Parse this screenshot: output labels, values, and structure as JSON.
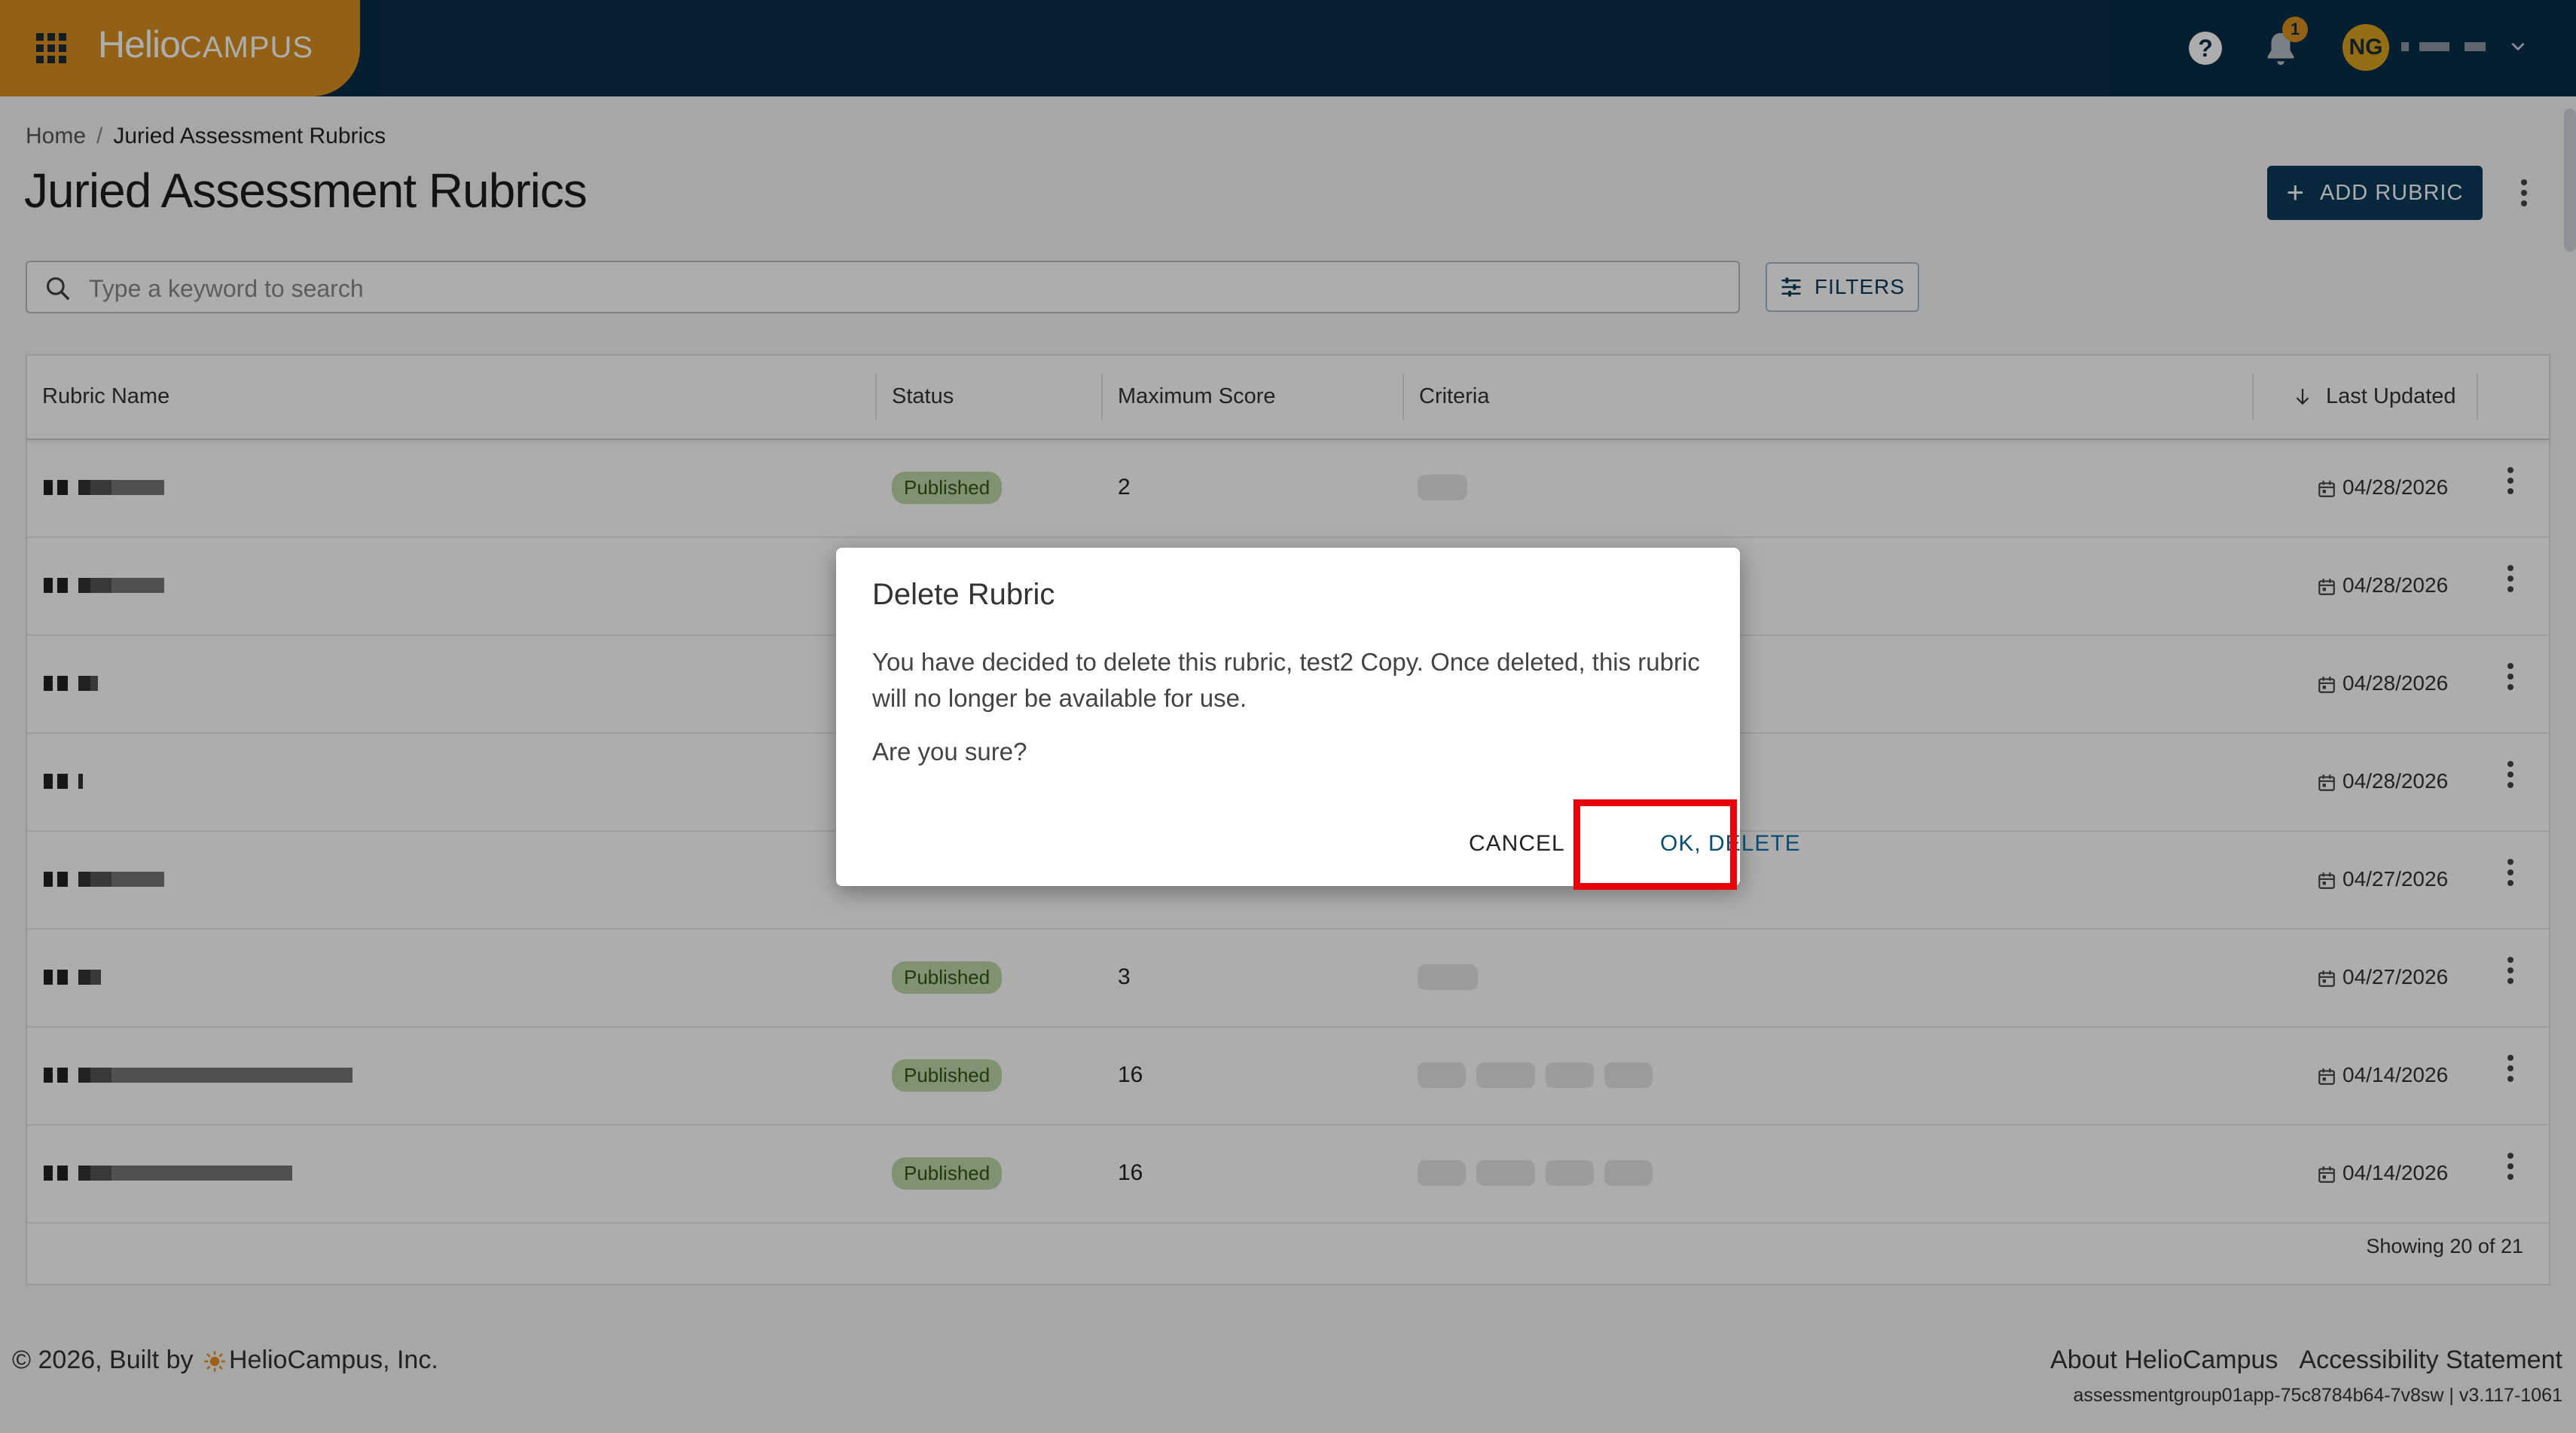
{
  "topbar": {
    "logo_bold": "Helio",
    "logo_light": "CAMPUS",
    "help_label": "?",
    "notification_count": "1",
    "avatar_initials": "NG"
  },
  "breadcrumb": {
    "home": "Home",
    "separator": "/",
    "current": "Juried Assessment Rubrics"
  },
  "page_title": "Juried Assessment Rubrics",
  "actions": {
    "add_label": "ADD RUBRIC",
    "filters_label": "FILTERS"
  },
  "search": {
    "placeholder": "Type a keyword to search"
  },
  "table": {
    "headers": {
      "name": "Rubric Name",
      "status": "Status",
      "max_score": "Maximum Score",
      "criteria": "Criteria",
      "updated": "Last Updated"
    },
    "rows": [
      {
        "status": "Published",
        "max_score": "2",
        "updated": "04/28/2026"
      },
      {
        "status": "",
        "max_score": "",
        "updated": "04/28/2026"
      },
      {
        "status": "",
        "max_score": "",
        "updated": "04/28/2026"
      },
      {
        "status": "",
        "max_score": "",
        "updated": "04/28/2026"
      },
      {
        "status": "",
        "max_score": "",
        "updated": "04/27/2026"
      },
      {
        "status": "Published",
        "max_score": "3",
        "updated": "04/27/2026"
      },
      {
        "status": "Published",
        "max_score": "16",
        "updated": "04/14/2026"
      },
      {
        "status": "Published",
        "max_score": "16",
        "updated": "04/14/2026"
      }
    ],
    "count_text": "Showing 20 of 21"
  },
  "footer": {
    "copyright_prefix": "© 2026, Built by",
    "company": "HelioCampus, Inc.",
    "link_about": "About HelioCampus",
    "link_accessibility": "Accessibility Statement",
    "build_info": "assessmentgroup01app-75c8784b64-7v8sw | v3.117-1061"
  },
  "dialog": {
    "title": "Delete Rubric",
    "body": "You have decided to delete this rubric, test2 Copy. Once deleted, this rubric will no longer be available for use.",
    "question": "Are you sure?",
    "cancel_label": "CANCEL",
    "confirm_label": "OK, DELETE"
  },
  "colors": {
    "topbar": "#0a2e47",
    "brand": "#d9901f",
    "primary_button": "#0b3a5a",
    "status_published": "#bfd7a8",
    "highlight": "#e8000b"
  }
}
